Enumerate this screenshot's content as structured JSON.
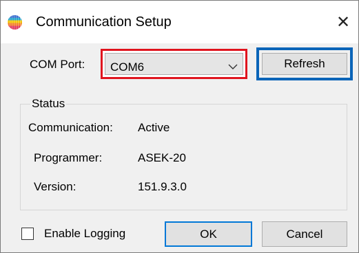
{
  "window": {
    "title": "Communication Setup",
    "app_icon": "striped-globe-icon",
    "close_icon": "close-icon"
  },
  "com_port": {
    "label": "COM Port:",
    "selected": "COM6",
    "highlight_color": "#e0141e"
  },
  "refresh_button": {
    "label": "Refresh",
    "highlight_color": "#0a64b8"
  },
  "status": {
    "group_label": "Status",
    "rows": [
      {
        "label": "Communication:",
        "value": "Active"
      },
      {
        "label": "Programmer:",
        "value": "ASEK-20"
      },
      {
        "label": "Version:",
        "value": "151.9.3.0"
      }
    ]
  },
  "logging": {
    "label": "Enable Logging",
    "checked": false
  },
  "buttons": {
    "ok": "OK",
    "cancel": "Cancel"
  }
}
